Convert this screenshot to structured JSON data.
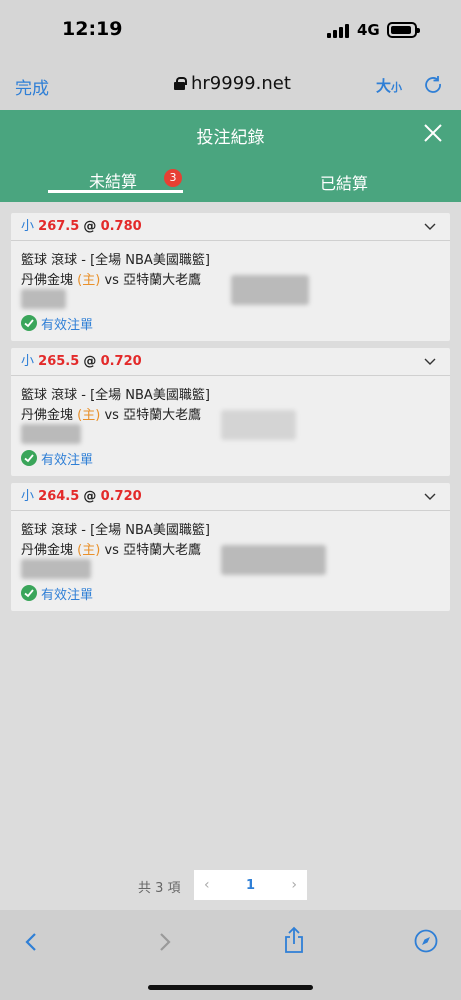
{
  "status_bar": {
    "time": "12:19",
    "network": "4G"
  },
  "browser": {
    "done_label": "完成",
    "url": "hr9999.net",
    "font_size_label_big": "大",
    "font_size_label_small": "小"
  },
  "modal": {
    "title": "投注紀錄"
  },
  "tabs": {
    "unsettled_label": "未結算",
    "unsettled_count": "3",
    "settled_label": "已結算"
  },
  "cards": [
    {
      "side": "小",
      "line": "267.5",
      "at": "@",
      "odds": "0.780",
      "sport_line": "籃球 滾球 - [全場 NBA美國職籃]",
      "home_team": "丹佛金塊",
      "home_tag": "(主)",
      "vs": "vs",
      "away_team": "亞特蘭大老鷹",
      "status": "有效注單"
    },
    {
      "side": "小",
      "line": "265.5",
      "at": "@",
      "odds": "0.720",
      "sport_line": "籃球 滾球 - [全場 NBA美國職籃]",
      "home_team": "丹佛金塊",
      "home_tag": "(主)",
      "vs": "vs",
      "away_team": "亞特蘭大老鷹",
      "status": "有效注單"
    },
    {
      "side": "小",
      "line": "264.5",
      "at": "@",
      "odds": "0.720",
      "sport_line": "籃球 滾球 - [全場 NBA美國職籃]",
      "home_team": "丹佛金塊",
      "home_tag": "(主)",
      "vs": "vs",
      "away_team": "亞特蘭大老鷹",
      "status": "有效注單"
    }
  ],
  "pagination": {
    "total_text": "共 3 項",
    "prev": "‹",
    "current_page": "1",
    "next": "›"
  },
  "colors": {
    "accent_green": "#4aa57f",
    "link_blue": "#2f7fd6",
    "odds_red": "#e32a2a",
    "home_orange": "#e9902a",
    "badge_red": "#e74033"
  },
  "icons": [
    "lock-icon",
    "reload-icon",
    "close-icon",
    "chevron-down-icon",
    "check-circle-icon",
    "back-icon",
    "forward-icon",
    "share-icon",
    "compass-icon"
  ]
}
